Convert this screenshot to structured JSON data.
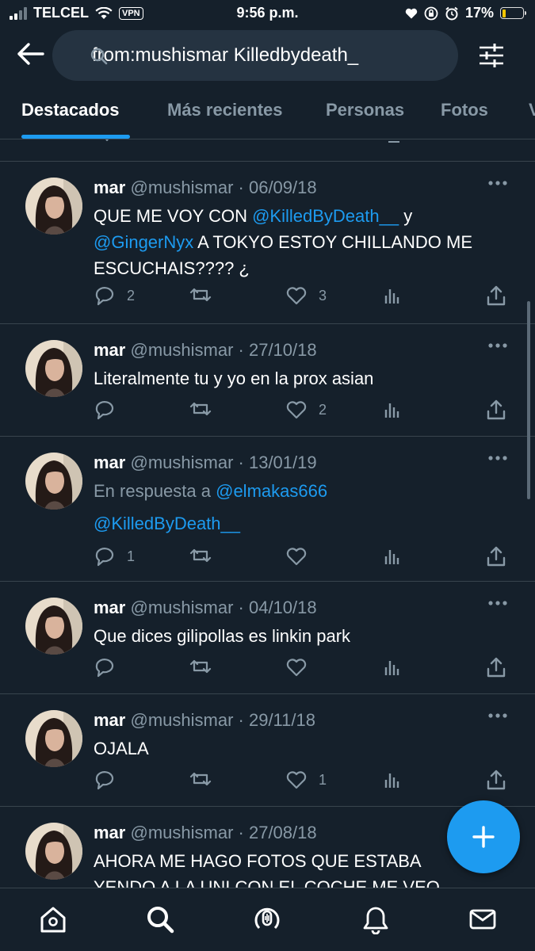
{
  "status_bar": {
    "carrier": "TELCEL",
    "vpn": "VPN",
    "time": "9:56 p.m.",
    "battery": "17%",
    "battery_level": 0.17
  },
  "search": {
    "query": "from:mushismar Killedbydeath_"
  },
  "tabs": [
    {
      "label": "Destacados",
      "active": true
    },
    {
      "label": "Más recientes",
      "active": false
    },
    {
      "label": "Personas",
      "active": false
    },
    {
      "label": "Fotos",
      "active": false
    },
    {
      "label": "V",
      "active": false
    }
  ],
  "tweets": [
    {
      "name": "mar",
      "handle": "@mushismar",
      "sep": "·",
      "date": "06/09/18",
      "text_parts": [
        {
          "t": "QUE ME VOY CON "
        },
        {
          "t": "@KilledByDeath__",
          "mention": true
        },
        {
          "t": " y "
        },
        {
          "t": "@GingerNyx",
          "mention": true
        },
        {
          "t": " A TOKYO ESTOY CHILLANDO ME ESCUCHAIS???? ¿"
        }
      ],
      "replies": "2",
      "retweets": "",
      "likes": "3"
    },
    {
      "name": "mar",
      "handle": "@mushismar",
      "sep": "·",
      "date": "27/10/18",
      "text": "Literalmente tu y yo en la prox asian",
      "replies": "",
      "retweets": "",
      "likes": "2"
    },
    {
      "name": "mar",
      "handle": "@mushismar",
      "sep": "·",
      "date": "13/01/19",
      "reply_label": "En respuesta a ",
      "reply_to": "@elmakas666",
      "text": "@KilledByDeath__",
      "replies": "1",
      "retweets": "",
      "likes": ""
    },
    {
      "name": "mar",
      "handle": "@mushismar",
      "sep": "·",
      "date": "04/10/18",
      "text": "Que dices gilipollas es linkin park",
      "replies": "",
      "retweets": "",
      "likes": ""
    },
    {
      "name": "mar",
      "handle": "@mushismar",
      "sep": "·",
      "date": "29/11/18",
      "text": "OJALA",
      "replies": "",
      "retweets": "",
      "likes": "1"
    },
    {
      "name": "mar",
      "handle": "@mushismar",
      "sep": "·",
      "date": "27/08/18",
      "text": "AHORA ME HAGO FOTOS QUE ESTABA YENDO A LA UNI CON EL COCHE ME VEO",
      "replies": "",
      "retweets": "",
      "likes": ""
    }
  ],
  "colors": {
    "background": "#15202b",
    "accent": "#1d9bf0",
    "muted": "#8899a6",
    "divider": "#38444d"
  },
  "icons": {
    "back": "back-arrow-icon",
    "search": "search-icon",
    "filter": "filter-sliders-icon",
    "reply": "reply-icon",
    "retweet": "retweet-icon",
    "like": "heart-icon",
    "analytics": "analytics-icon",
    "share": "share-icon",
    "compose": "plus-icon",
    "nav": [
      "home-icon",
      "search-icon",
      "spaces-icon",
      "notifications-icon",
      "messages-icon"
    ]
  }
}
